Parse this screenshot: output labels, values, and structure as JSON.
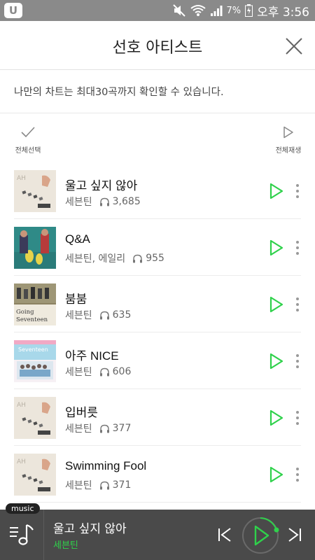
{
  "status_bar": {
    "app_badge": "U",
    "battery": "7%",
    "time": "오후 3:56"
  },
  "header": {
    "title": "선호 아티스트"
  },
  "info": {
    "text": "나만의 차트는 최대30곡까지 확인할 수 있습니다."
  },
  "controls": {
    "select_all": "전체선택",
    "play_all": "전체재생"
  },
  "songs": [
    {
      "title": "울고 싶지 않아",
      "artist": "세븐틴",
      "plays": "3,685",
      "cover": "cover-al1"
    },
    {
      "title": "Q&A",
      "artist": "세븐틴, 에일리",
      "plays": "955",
      "cover": "cover-qa"
    },
    {
      "title": "붐붐",
      "artist": "세븐틴",
      "plays": "635",
      "cover": "cover-going",
      "cover_text": [
        "Going",
        "Seventeen"
      ]
    },
    {
      "title": "아주 NICE",
      "artist": "세븐틴",
      "plays": "606",
      "cover": "cover-lovepop",
      "cover_text": [
        "Seventeen"
      ]
    },
    {
      "title": "입버릇",
      "artist": "세븐틴",
      "plays": "377",
      "cover": "cover-al1"
    },
    {
      "title": "Swimming Fool",
      "artist": "세븐틴",
      "plays": "371",
      "cover": "cover-al1"
    }
  ],
  "player": {
    "badge": "music",
    "title": "울고 싶지 않아",
    "artist": "세븐틴"
  },
  "colors": {
    "accent": "#2fd14b",
    "status_bar": "#8a8a8a",
    "player_bg": "#4a4a4a"
  }
}
